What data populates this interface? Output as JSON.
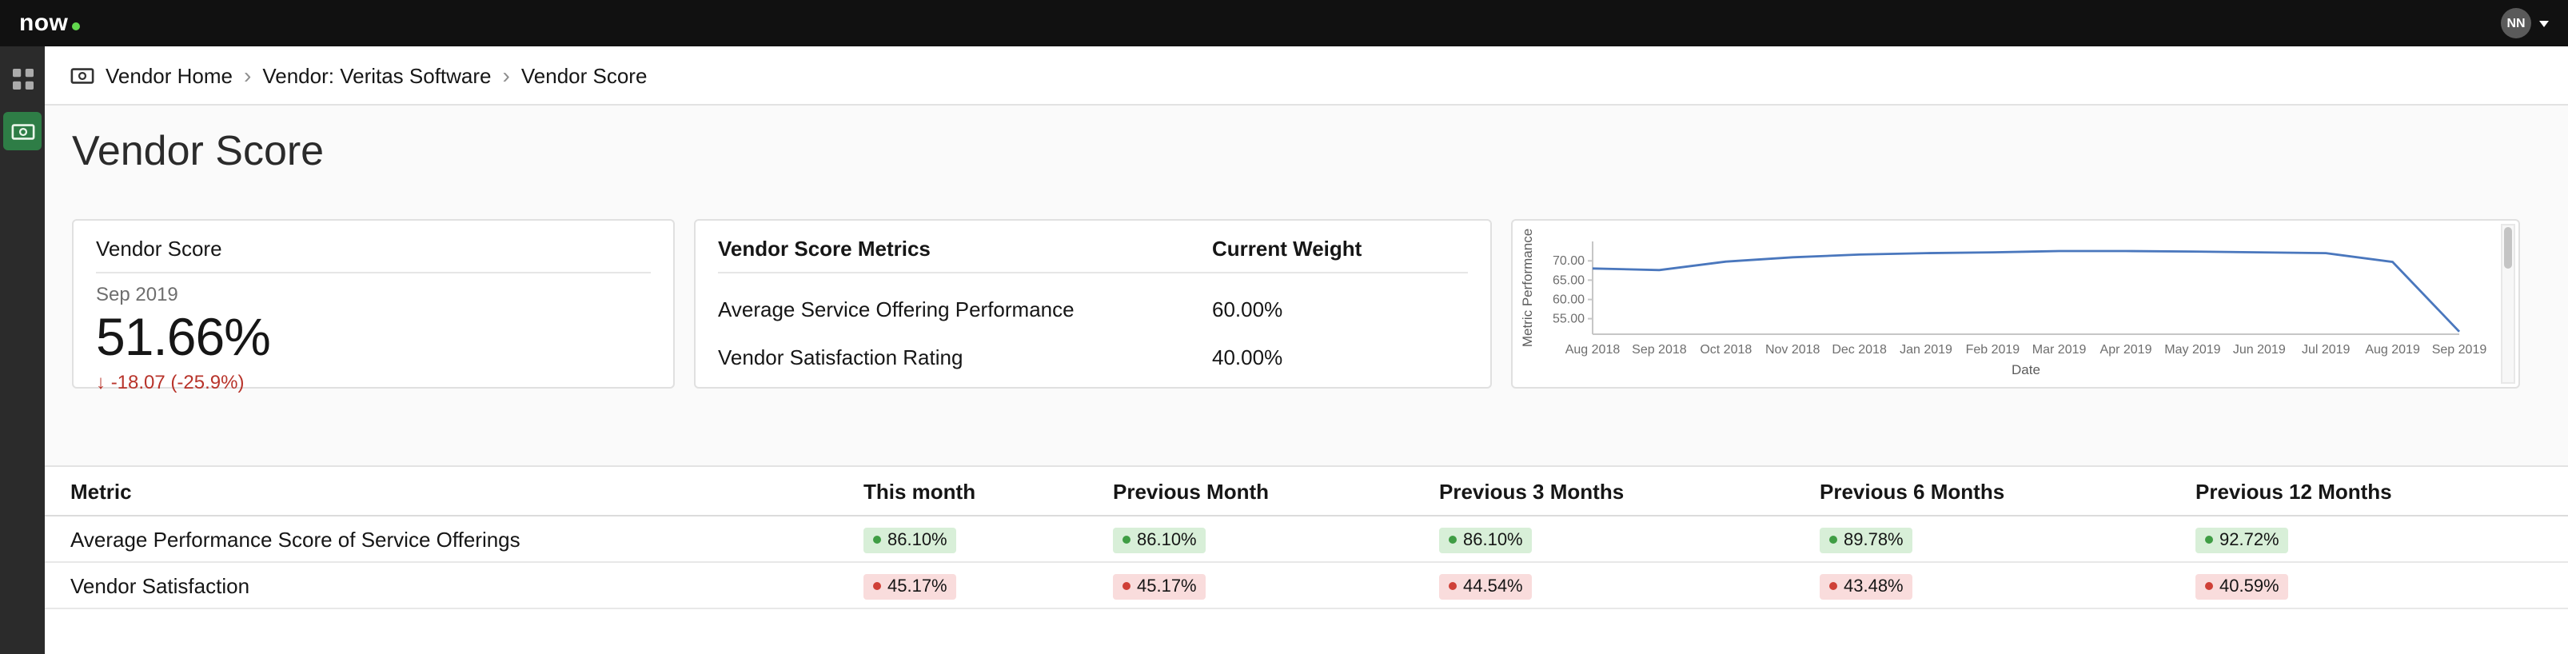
{
  "topbar": {
    "logo_text": "now",
    "user_initials": "NN"
  },
  "breadcrumb": {
    "separator": "›",
    "items": [
      "Vendor Home",
      "Vendor: Veritas Software",
      "Vendor Score"
    ]
  },
  "page": {
    "title": "Vendor Score"
  },
  "score_card": {
    "title": "Vendor Score",
    "period": "Sep 2019",
    "value": "51.66%",
    "change_arrow": "↓",
    "change": "-18.07 (-25.9%)"
  },
  "metrics_card": {
    "title": "Vendor Score Metrics",
    "weight_header": "Current Weight",
    "rows": [
      {
        "label": "Average Service Offering Performance",
        "weight": "60.00%"
      },
      {
        "label": "Vendor Satisfaction Rating",
        "weight": "40.00%"
      }
    ]
  },
  "chart_data": {
    "type": "line",
    "title": "",
    "xlabel": "Date",
    "ylabel": "Metric Performance",
    "categories": [
      "Aug 2018",
      "Sep 2018",
      "Oct 2018",
      "Nov 2018",
      "Dec 2018",
      "Jan 2019",
      "Feb 2019",
      "Mar 2019",
      "Apr 2019",
      "May 2019",
      "Jun 2019",
      "Jul 2019",
      "Aug 2019",
      "Sep 2019"
    ],
    "values": [
      68.0,
      67.6,
      69.8,
      70.9,
      71.6,
      72.0,
      72.2,
      72.5,
      72.5,
      72.4,
      72.2,
      72.0,
      69.7,
      51.66
    ],
    "yticks": [
      "70.00",
      "65.00",
      "60.00",
      "55.00"
    ],
    "ylim": [
      51,
      75
    ],
    "line_color": "#4a77bd",
    "grid": false,
    "legend": "none"
  },
  "table": {
    "headers": [
      "Metric",
      "This month",
      "Previous Month",
      "Previous 3 Months",
      "Previous 6 Months",
      "Previous 12 Months"
    ],
    "rows": [
      {
        "metric": "Average Performance Score of Service Offerings",
        "status": "positive",
        "values": [
          "86.10%",
          "86.10%",
          "86.10%",
          "89.78%",
          "92.72%"
        ]
      },
      {
        "metric": "Vendor Satisfaction",
        "status": "negative",
        "values": [
          "45.17%",
          "45.17%",
          "44.54%",
          "43.48%",
          "40.59%"
        ]
      }
    ]
  },
  "colors": {
    "brand_green": "#62d84e",
    "chart_line": "#4a77bd",
    "positive_badge_bg": "#d8efd8",
    "positive_dot": "#3f9d44",
    "negative_badge_bg": "#f9dcdc",
    "negative_dot": "#cf4037",
    "negative_text": "#b8342b"
  }
}
